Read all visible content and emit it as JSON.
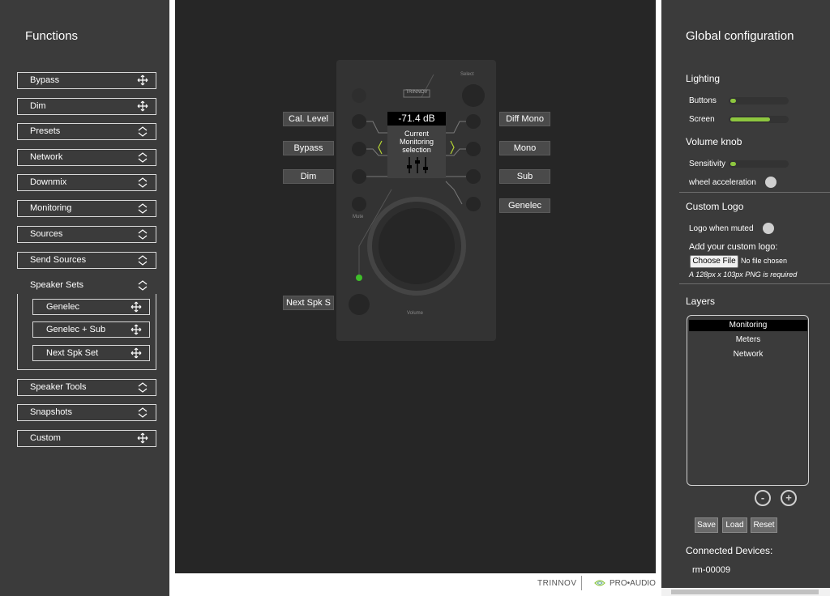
{
  "left_panel": {
    "title": "Functions",
    "buttons": [
      {
        "label": "Bypass",
        "icon": "move-icon"
      },
      {
        "label": "Dim",
        "icon": "move-icon"
      },
      {
        "label": "Presets",
        "icon": "expand-icon"
      },
      {
        "label": "Network",
        "icon": "expand-icon"
      },
      {
        "label": "Downmix",
        "icon": "expand-icon"
      },
      {
        "label": "Monitoring",
        "icon": "expand-icon"
      },
      {
        "label": "Sources",
        "icon": "expand-icon"
      },
      {
        "label": "Send Sources",
        "icon": "expand-icon"
      }
    ],
    "speaker_sets": {
      "label": "Speaker Sets",
      "items": [
        "Genelec",
        "Genelec + Sub",
        "Next Spk Set"
      ]
    },
    "buttons_bottom": [
      {
        "label": "Speaker Tools",
        "icon": "expand-icon"
      },
      {
        "label": "Snapshots",
        "icon": "expand-icon"
      },
      {
        "label": "Custom",
        "icon": "move-icon"
      }
    ]
  },
  "device": {
    "left_labels": [
      "Cal. Level",
      "Bypass",
      "Dim"
    ],
    "right_labels": [
      "Diff Mono",
      "Mono",
      "Sub",
      "Genelec"
    ],
    "next_label": "Next Spk S",
    "screen_value": "-71.4 dB",
    "screen_lines": [
      "Current",
      "Monitoring",
      "selection"
    ],
    "select_label": "Select",
    "mute_label": "Mute",
    "volume_label": "Volume",
    "brand": "TRINNOV",
    "led_color": "#3fbf2a"
  },
  "footer": {
    "brand": "TRINNOV",
    "product": "PRO•AUDIO"
  },
  "right_panel": {
    "title": "Global configuration",
    "lighting": {
      "heading": "Lighting",
      "buttons_label": "Buttons",
      "buttons_level": 0.1,
      "screen_label": "Screen",
      "screen_level": 0.7
    },
    "volume_knob": {
      "heading": "Volume knob",
      "sensitivity_label": "Sensitivity",
      "sensitivity_level": 0.1,
      "wheel_label": "wheel acceleration"
    },
    "custom_logo": {
      "heading": "Custom Logo",
      "muted_label": "Logo when muted",
      "add_label": "Add your custom logo:",
      "choose_label": "Choose File",
      "no_file": "No file chosen",
      "hint": "A 128px x 103px PNG is required"
    },
    "layers": {
      "heading": "Layers",
      "items": [
        "Monitoring",
        "Meters",
        "Network"
      ],
      "selected": "Monitoring",
      "remove_symbol": "-",
      "add_symbol": "+"
    },
    "actions": [
      "Save",
      "Load",
      "Reset"
    ],
    "connected": {
      "heading": "Connected Devices:",
      "device": "rm-00009"
    }
  },
  "colors": {
    "panel": "#3b3b3b",
    "canvas": "#262626",
    "accent": "#8dc63f"
  }
}
